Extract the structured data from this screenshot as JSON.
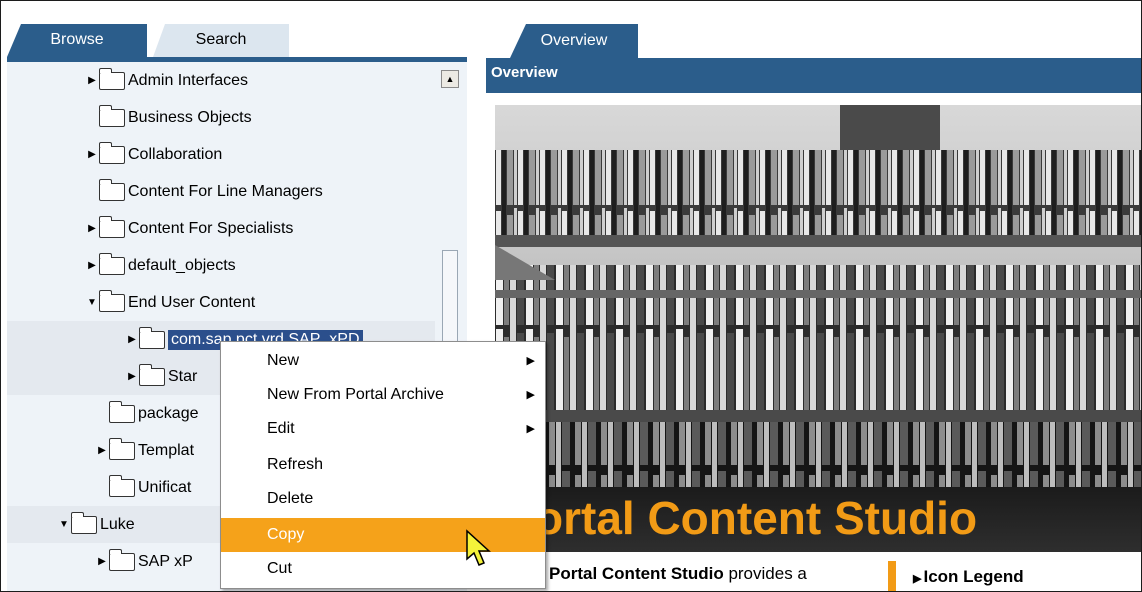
{
  "left_tabs": [
    {
      "label": "Browse",
      "active": true
    },
    {
      "label": "Search",
      "active": false
    }
  ],
  "tree": {
    "items": [
      {
        "label": "Admin Interfaces",
        "has_children": true,
        "expanded": false
      },
      {
        "label": "Business Objects",
        "has_children": false,
        "expanded": false
      },
      {
        "label": "Collaboration",
        "has_children": true,
        "expanded": false
      },
      {
        "label": "Content For Line Managers",
        "has_children": false,
        "expanded": false
      },
      {
        "label": "Content For Specialists",
        "has_children": true,
        "expanded": false
      },
      {
        "label": "default_objects",
        "has_children": true,
        "expanded": false
      },
      {
        "label": "End User Content",
        "has_children": true,
        "expanded": true
      },
      {
        "label": "com.sap.pct.vrd.SAP_xPD",
        "has_children": true,
        "expanded": false,
        "selected": true
      },
      {
        "label": "Star",
        "has_children": true,
        "expanded": false
      },
      {
        "label": "package",
        "has_children": false,
        "expanded": false
      },
      {
        "label": "Templat",
        "has_children": true,
        "expanded": false
      },
      {
        "label": "Unificat",
        "has_children": false,
        "expanded": false
      },
      {
        "label": "Luke",
        "has_children": true,
        "expanded": true
      },
      {
        "label": "SAP xP",
        "has_children": true,
        "expanded": false
      }
    ]
  },
  "right_tab": {
    "label": "Overview"
  },
  "overview": {
    "header": "Overview",
    "banner_title": "ortal Content Studio",
    "description_bold": "Portal Content Studio",
    "description_rest": " provides a",
    "legend_label": "Icon Legend"
  },
  "context_menu": {
    "items": [
      {
        "label": "New",
        "submenu": true
      },
      {
        "label": "New From Portal Archive",
        "submenu": true
      },
      {
        "label": "Edit",
        "submenu": true
      },
      {
        "label": "Refresh",
        "submenu": false
      },
      {
        "label": "Delete",
        "submenu": false
      },
      {
        "label": "Copy",
        "submenu": false,
        "highlighted": true
      },
      {
        "label": "Cut",
        "submenu": false
      }
    ]
  },
  "colors": {
    "accent_blue": "#2b5d8b",
    "highlight_orange": "#f5a21a",
    "banner_orange": "#f29b16"
  }
}
